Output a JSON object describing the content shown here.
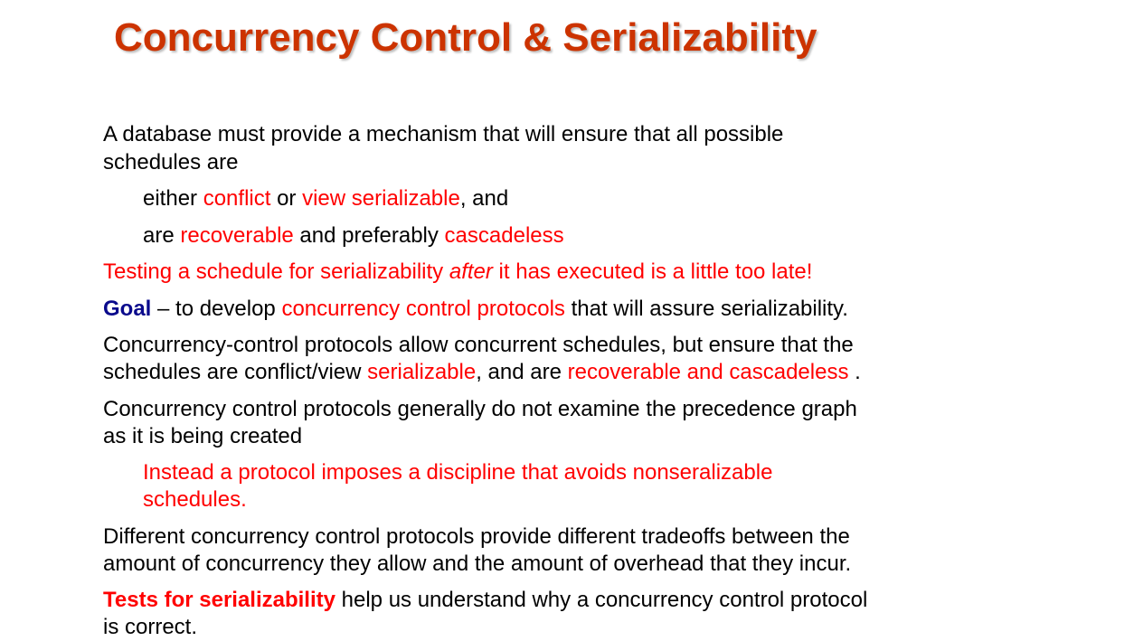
{
  "title": "Concurrency Control & Serializability",
  "p1": {
    "line1": "A database must provide a mechanism that will ensure that all possible",
    "line2": "schedules are"
  },
  "sub1": {
    "t1": "either ",
    "r1": "conflict",
    "t2": " or ",
    "r2": "view serializable",
    "t3": ", and"
  },
  "sub2": {
    "t1": "are ",
    "r1": "recoverable",
    "t2": " and preferably ",
    "r2": "cascadeless"
  },
  "p2": {
    "r1": "Testing a schedule for serializability ",
    "ri": "after",
    "r2": " it has executed is a little too late!"
  },
  "p3": {
    "goal": "Goal",
    "t1": " – to develop ",
    "r1": "concurrency control protocols",
    "t2": " that will assure serializability."
  },
  "p4": {
    "line1": "Concurrency-control protocols allow concurrent schedules, but ensure that the",
    "t1": "schedules are conflict/view ",
    "r1": "serializable",
    "t2": ", and are ",
    "r2": "recoverable and cascadeless",
    "t3": " ."
  },
  "p5": {
    "line1": "Concurrency control protocols generally do not examine the precedence graph",
    "line2": "as it is being created"
  },
  "sub3": {
    "line1": "Instead a protocol imposes a discipline that avoids nonseralizable",
    "line2": "schedules."
  },
  "p6": {
    "line1": "Different concurrency control protocols provide different tradeoffs between the",
    "line2": "amount of concurrency they allow and the amount of overhead that they incur."
  },
  "p7": {
    "r1": "Tests for serializability",
    "t1": " help us understand why a concurrency control protocol",
    "line2": "is correct."
  }
}
